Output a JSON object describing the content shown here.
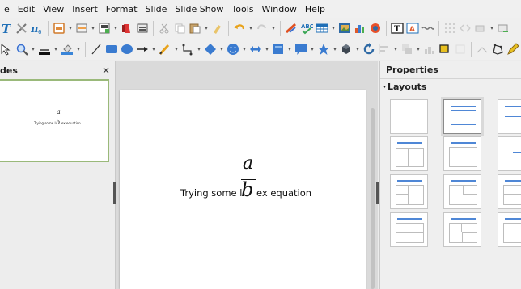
{
  "menu": [
    "e",
    "Edit",
    "View",
    "Insert",
    "Format",
    "Slide",
    "Slide Show",
    "Tools",
    "Window",
    "Help"
  ],
  "slides_panel": {
    "title": "des",
    "close": "×"
  },
  "thumbnail": {
    "numerator": "a",
    "denominator": "b",
    "text_before": "Trying some l",
    "text_after": "ex equation"
  },
  "slide": {
    "numerator": "a",
    "denominator": "b",
    "text_before": "Trying some l",
    "text_after": "ex equation"
  },
  "properties": {
    "title": "Properties",
    "layouts_label": "Layouts"
  },
  "colors": {
    "accent_blue": "#4f87d6",
    "thumbnail_border": "#9ab97a",
    "workspace_bg": "#dadada"
  },
  "toolbar1_icons": [
    "text-icon",
    "toolbox-icon",
    "math-icon",
    "open-icon",
    "save-icon",
    "export-pdf-icon",
    "print-icon",
    "cut-icon",
    "copy-icon",
    "paste-icon",
    "clone-icon",
    "undo-icon",
    "redo-icon",
    "clear-format-icon",
    "spellcheck-icon",
    "table-icon",
    "image-icon",
    "chart-icon",
    "media-icon",
    "textbox-icon",
    "fontwork-icon",
    "special-char-icon",
    "grid-icon",
    "helpline-icon",
    "slide-show-icon",
    "link-icon"
  ],
  "toolbar2_icons": [
    "select-icon",
    "zoom-icon",
    "line-color-icon",
    "fill-color-icon",
    "line-icon",
    "rect-icon",
    "ellipse-icon",
    "arrow-icon",
    "curve-icon",
    "connector-icon",
    "basic-shapes-icon",
    "symbol-shapes-icon",
    "block-arrows-icon",
    "flowchart-icon",
    "callout-icon",
    "stars-icon",
    "3d-objects-icon",
    "rotate-icon",
    "align-icon",
    "arrange-icon",
    "distribute-icon",
    "shadow-icon",
    "crop-icon",
    "points-icon",
    "glue-icon"
  ]
}
